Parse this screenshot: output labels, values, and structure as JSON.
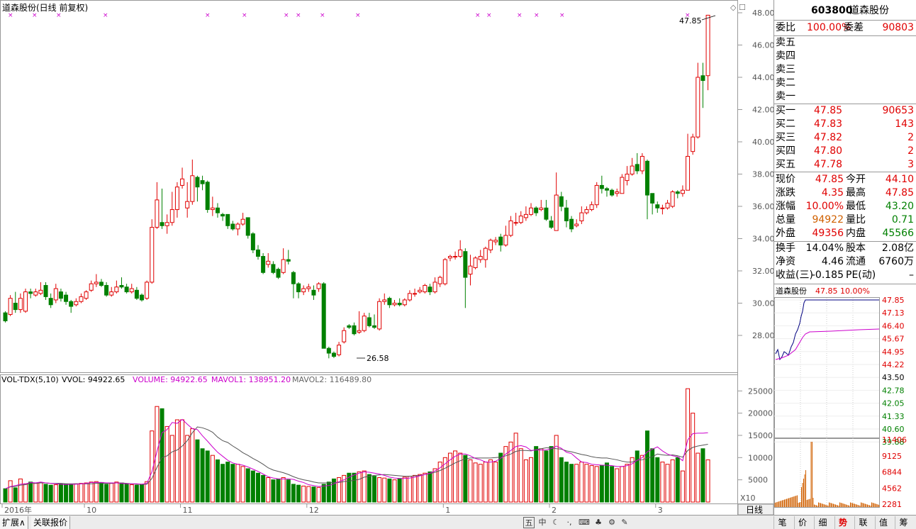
{
  "chart": {
    "title": "道森股份(日线 前复权)",
    "price_axis_ticks": [
      "48.00",
      "46.00",
      "44.00",
      "42.00",
      "40.00",
      "38.00",
      "36.00",
      "34.00",
      "32.00",
      "30.00",
      "28.00"
    ],
    "high_marker": "47.85",
    "low_marker": "26.58",
    "vol_legend": {
      "name": "VOL-TDX(5,10)",
      "vvol": "VVOL: 94922.65",
      "volume": "VOLUME: 94922.65",
      "mavol1": "MAVOL1: 138951.20",
      "mavol2": "MAVOL2: 116489.80"
    },
    "vol_axis_ticks": [
      "25000",
      "20000",
      "15000",
      "10000",
      "5000"
    ],
    "vol_unit": "X10",
    "period_label": "日线",
    "date_labels": [
      "2016年",
      "10",
      "11",
      "12",
      "1",
      "2",
      "3"
    ],
    "colors": {
      "up": "#e00000",
      "down": "#008000",
      "ma1": "#cc00cc",
      "ma2": "#555555",
      "marker": "#cc00cc"
    }
  },
  "chart_data": {
    "type": "candlestick",
    "title": "道森股份(日线 前复权)",
    "ylim": [
      26,
      48
    ],
    "candles": [
      [
        29.4,
        28.9,
        29.5,
        28.8
      ],
      [
        29.3,
        30.3,
        30.5,
        29.2
      ],
      [
        30.0,
        29.6,
        30.7,
        29.4
      ],
      [
        29.6,
        30.3,
        30.6,
        29.4
      ],
      [
        29.5,
        30.7,
        30.9,
        29.4
      ],
      [
        30.7,
        30.6,
        30.9,
        30.3
      ],
      [
        30.5,
        30.7,
        30.9,
        30.4
      ],
      [
        30.6,
        30.8,
        31.3,
        30.5
      ],
      [
        31.1,
        30.4,
        31.3,
        30.2
      ],
      [
        30.3,
        29.9,
        30.6,
        29.7
      ],
      [
        30.2,
        30.9,
        31.2,
        30.0
      ],
      [
        30.7,
        30.3,
        30.9,
        30.1
      ],
      [
        30.5,
        30.1,
        30.7,
        29.9
      ],
      [
        30.1,
        29.8,
        30.2,
        29.4
      ],
      [
        29.9,
        30.1,
        30.3,
        29.8
      ],
      [
        30.1,
        30.4,
        30.6,
        30.0
      ],
      [
        30.3,
        30.7,
        30.8,
        30.2
      ],
      [
        30.8,
        31.2,
        31.4,
        30.7
      ],
      [
        31.2,
        31.3,
        31.8,
        31.0
      ],
      [
        31.3,
        31.1,
        31.5,
        31.0
      ],
      [
        31.1,
        30.5,
        31.3,
        30.4
      ],
      [
        30.5,
        30.7,
        31.0,
        30.4
      ],
      [
        30.7,
        31.0,
        31.4,
        30.6
      ],
      [
        31.1,
        31.0,
        31.6,
        30.9
      ],
      [
        31.0,
        30.7,
        31.2,
        30.6
      ],
      [
        30.7,
        30.9,
        31.2,
        30.6
      ],
      [
        30.8,
        30.3,
        31.0,
        30.2
      ],
      [
        30.5,
        30.2,
        30.6,
        30.1
      ],
      [
        30.3,
        31.3,
        31.4,
        30.2
      ],
      [
        31.3,
        34.7,
        35.2,
        31.2
      ],
      [
        34.7,
        36.4,
        37.5,
        34.6
      ],
      [
        35.0,
        34.8,
        37.1,
        34.6
      ],
      [
        34.8,
        35.0,
        35.5,
        34.3
      ],
      [
        35.0,
        35.8,
        36.9,
        34.8
      ],
      [
        35.8,
        37.2,
        37.5,
        35.3
      ],
      [
        37.3,
        37.7,
        38.4,
        37.1
      ],
      [
        35.9,
        36.3,
        37.5,
        35.3
      ],
      [
        36.3,
        37.9,
        38.9,
        36.1
      ],
      [
        37.8,
        37.2,
        37.9,
        36.3
      ],
      [
        37.6,
        37.4,
        37.9,
        37.0
      ],
      [
        37.5,
        35.8,
        37.6,
        35.6
      ],
      [
        35.8,
        35.9,
        36.6,
        35.4
      ],
      [
        35.9,
        35.6,
        36.2,
        35.3
      ],
      [
        35.5,
        35.4,
        35.6,
        35.1
      ],
      [
        35.5,
        34.8,
        35.5,
        34.6
      ],
      [
        34.9,
        34.6,
        35.1,
        34.5
      ],
      [
        34.6,
        34.9,
        35.0,
        34.2
      ],
      [
        34.9,
        35.2,
        35.6,
        34.8
      ],
      [
        35.3,
        34.2,
        35.3,
        34.0
      ],
      [
        34.3,
        33.3,
        34.4,
        33.1
      ],
      [
        33.3,
        32.9,
        33.6,
        32.7
      ],
      [
        32.9,
        31.9,
        33.1,
        31.8
      ],
      [
        32.4,
        32.6,
        33.1,
        32.2
      ],
      [
        32.4,
        31.9,
        32.6,
        31.8
      ],
      [
        32.1,
        31.6,
        32.2,
        31.5
      ],
      [
        31.9,
        32.7,
        33.4,
        31.8
      ],
      [
        32.7,
        32.6,
        33.3,
        32.4
      ],
      [
        31.9,
        31.2,
        32.0,
        30.3
      ],
      [
        31.2,
        30.7,
        31.3,
        30.3
      ],
      [
        30.7,
        30.9,
        31.1,
        30.5
      ],
      [
        30.9,
        31.0,
        31.2,
        30.7
      ],
      [
        30.8,
        30.5,
        31.1,
        30.2
      ],
      [
        30.9,
        31.2,
        31.3,
        30.7
      ],
      [
        31.2,
        27.2,
        31.3,
        27.2
      ],
      [
        27.2,
        26.9,
        27.3,
        26.58
      ],
      [
        26.9,
        26.7,
        27.0,
        26.6
      ],
      [
        26.8,
        27.4,
        27.6,
        26.7
      ],
      [
        27.6,
        28.3,
        28.5,
        27.5
      ],
      [
        28.6,
        28.5,
        28.7,
        28.4
      ],
      [
        28.6,
        28.1,
        28.8,
        28.0
      ],
      [
        28.2,
        28.3,
        29.5,
        28.1
      ],
      [
        28.3,
        29.2,
        29.4,
        28.2
      ],
      [
        29.1,
        28.6,
        29.4,
        28.5
      ],
      [
        28.6,
        28.5,
        29.3,
        28.4
      ],
      [
        28.4,
        30.1,
        30.3,
        28.3
      ],
      [
        30.1,
        30.2,
        30.6,
        29.9
      ],
      [
        30.3,
        29.9,
        30.4,
        29.7
      ],
      [
        29.9,
        30.0,
        30.2,
        29.8
      ],
      [
        30.0,
        29.9,
        30.3,
        29.8
      ],
      [
        29.9,
        30.2,
        30.3,
        29.8
      ],
      [
        30.2,
        30.6,
        30.8,
        30.1
      ],
      [
        30.6,
        30.6,
        30.9,
        30.4
      ],
      [
        30.7,
        30.8,
        31.0,
        30.6
      ],
      [
        30.7,
        31.1,
        31.2,
        30.6
      ],
      [
        31.0,
        30.7,
        31.2,
        30.5
      ],
      [
        30.7,
        31.3,
        31.6,
        30.6
      ],
      [
        31.2,
        31.6,
        31.7,
        31.0
      ],
      [
        31.2,
        32.7,
        32.8,
        31.1
      ],
      [
        32.8,
        32.9,
        33.0,
        32.6
      ],
      [
        32.9,
        32.9,
        33.2,
        32.7
      ],
      [
        32.9,
        33.3,
        33.9,
        32.8
      ],
      [
        33.2,
        31.6,
        33.4,
        29.7
      ],
      [
        31.8,
        32.3,
        33.0,
        31.1
      ],
      [
        32.2,
        32.8,
        32.9,
        32.1
      ],
      [
        32.7,
        32.9,
        33.3,
        32.5
      ],
      [
        32.7,
        33.4,
        33.5,
        32.2
      ],
      [
        33.3,
        33.9,
        34.0,
        33.1
      ],
      [
        33.8,
        33.9,
        34.1,
        33.6
      ],
      [
        34.1,
        33.6,
        34.3,
        33.2
      ],
      [
        33.6,
        34.2,
        34.8,
        33.5
      ],
      [
        34.2,
        35.1,
        35.4,
        34.1
      ],
      [
        35.0,
        35.0,
        35.6,
        34.8
      ],
      [
        35.0,
        35.4,
        35.7,
        34.9
      ],
      [
        35.3,
        35.5,
        36.0,
        35.1
      ],
      [
        35.5,
        35.9,
        36.2,
        35.4
      ],
      [
        35.9,
        35.6,
        36.0,
        35.4
      ],
      [
        35.8,
        35.9,
        36.4,
        35.7
      ],
      [
        35.9,
        35.2,
        36.4,
        35.1
      ],
      [
        35.1,
        34.7,
        35.4,
        34.6
      ],
      [
        34.5,
        36.7,
        38.1,
        34.5
      ],
      [
        36.6,
        36.0,
        36.9,
        35.7
      ],
      [
        35.9,
        35.1,
        36.4,
        34.7
      ],
      [
        35.2,
        34.6,
        35.4,
        34.4
      ],
      [
        34.8,
        34.9,
        35.2,
        34.7
      ],
      [
        35.1,
        35.6,
        36.0,
        34.9
      ],
      [
        35.6,
        35.8,
        36.0,
        35.5
      ],
      [
        35.8,
        36.1,
        36.3,
        35.7
      ],
      [
        36.1,
        37.3,
        37.5,
        35.9
      ],
      [
        37.3,
        37.1,
        37.9,
        36.8
      ],
      [
        37.1,
        37.0,
        37.2,
        36.6
      ],
      [
        37.0,
        36.7,
        37.1,
        36.6
      ],
      [
        36.8,
        36.9,
        37.1,
        36.6
      ],
      [
        36.8,
        37.8,
        38.0,
        36.8
      ],
      [
        37.6,
        38.0,
        38.5,
        37.3
      ],
      [
        38.0,
        38.5,
        39.0,
        37.9
      ],
      [
        38.6,
        38.2,
        39.3,
        38.0
      ],
      [
        38.2,
        39.1,
        39.3,
        38.0
      ],
      [
        38.8,
        36.7,
        38.9,
        35.2
      ],
      [
        36.8,
        36.2,
        36.8,
        35.5
      ],
      [
        36.1,
        35.9,
        36.3,
        35.6
      ],
      [
        35.9,
        35.9,
        36.1,
        35.5
      ],
      [
        35.9,
        36.2,
        36.4,
        35.8
      ],
      [
        36.0,
        36.9,
        37.0,
        35.9
      ],
      [
        36.9,
        36.8,
        37.0,
        36.5
      ],
      [
        36.8,
        37.0,
        37.3,
        36.6
      ],
      [
        37.0,
        39.1,
        40.5,
        37.0
      ],
      [
        39.4,
        40.3,
        40.5,
        39.2
      ],
      [
        40.3,
        44.0,
        44.9,
        40.2
      ],
      [
        44.1,
        43.8,
        44.9,
        42.1
      ],
      [
        44.1,
        47.85,
        47.85,
        43.2
      ]
    ],
    "volumes": [
      3000,
      4800,
      3200,
      5200,
      4100,
      4500,
      4200,
      4400,
      4000,
      3800,
      3900,
      4100,
      4000,
      3900,
      4100,
      4200,
      4300,
      4500,
      4600,
      4400,
      4000,
      4200,
      4500,
      4300,
      4100,
      3900,
      3800,
      3900,
      4600,
      16000,
      21500,
      21000,
      17000,
      15000,
      18500,
      18500,
      15000,
      16500,
      14000,
      12000,
      11500,
      10500,
      9500,
      8500,
      9000,
      8500,
      8500,
      8000,
      7500,
      7000,
      6500,
      6000,
      5500,
      5000,
      5200,
      5500,
      5000,
      4000,
      3800,
      3600,
      3500,
      3400,
      3300,
      4000,
      4500,
      5200,
      5500,
      6000,
      6500,
      6500,
      6800,
      7000,
      6200,
      5800,
      5500,
      5400,
      5200,
      5000,
      5300,
      5600,
      5800,
      6000,
      6200,
      6500,
      6800,
      7500,
      9000,
      10000,
      11000,
      11500,
      11000,
      10500,
      9500,
      8800,
      8500,
      9000,
      9500,
      9000,
      11000,
      12500,
      13500,
      15500,
      12000,
      9500,
      10000,
      12500,
      12000,
      11500,
      12500,
      15000,
      10000,
      9000,
      8500,
      8500,
      9000,
      8500,
      8200,
      8000,
      8200,
      8800,
      8000,
      7500,
      8000,
      8500,
      10000,
      11500,
      10500,
      16000,
      12000,
      10000,
      9000,
      8500,
      9500,
      10000,
      7000,
      25500,
      20000,
      11000,
      12000,
      9500
    ],
    "vol_ylim": [
      0,
      26000
    ],
    "ma1": [
      3000,
      3500,
      3700,
      4000,
      4100,
      4400,
      4300,
      4500,
      4300,
      4200,
      4100,
      4000,
      3900,
      4000,
      4000,
      4100,
      4200,
      4400,
      4400,
      4400,
      4300,
      4300,
      4300,
      4200,
      4100,
      4100,
      4100,
      4000,
      4200,
      6800,
      11400,
      15600,
      16300,
      17900,
      17700,
      18600,
      17500,
      16500,
      16300,
      14900,
      13700,
      12400,
      11200,
      10300,
      9400,
      8800,
      8500,
      8300,
      7900,
      7400,
      6900,
      6300,
      5700,
      5400,
      5200,
      5200,
      5200,
      5100,
      4700,
      4400,
      3900,
      3700,
      3500,
      3600,
      3700,
      4100,
      4600,
      5000,
      5600,
      6100,
      6500,
      6800,
      6700,
      6500,
      6300,
      6000,
      5600,
      5400,
      5300,
      5300,
      5400,
      5600,
      5900,
      6200,
      6500,
      7000,
      7700,
      8600,
      9500,
      10300,
      10800,
      10800,
      10400,
      9800,
      9500,
      9000,
      9000,
      9200,
      9800,
      10800,
      11600,
      12500,
      12700,
      12400,
      11600,
      11700,
      11700,
      11700,
      12000,
      12600,
      12100,
      11200,
      10900,
      9900,
      9000,
      8900,
      8500,
      8400,
      8300,
      8300,
      8200,
      8000,
      8000,
      8200,
      8600,
      9400,
      10000,
      11300,
      11900,
      12400,
      11500,
      10800,
      10400,
      10200,
      9300,
      14000,
      15400,
      15500,
      15500,
      15600
    ],
    "ma2": [
      3000,
      3400,
      3500,
      3800,
      3900,
      4200,
      4200,
      4300,
      4300,
      4200,
      4200,
      4200,
      4100,
      4100,
      4100,
      4100,
      4100,
      4100,
      4200,
      4200,
      4200,
      4200,
      4300,
      4300,
      4200,
      4100,
      4000,
      4000,
      4000,
      5300,
      7800,
      10000,
      10400,
      11300,
      11700,
      12600,
      13800,
      15600,
      16900,
      16700,
      16300,
      15700,
      14600,
      13800,
      13400,
      12600,
      11900,
      11100,
      10500,
      9800,
      9200,
      8500,
      7700,
      7200,
      6900,
      6600,
      6200,
      5700,
      5300,
      5000,
      4800,
      4500,
      4300,
      4300,
      4300,
      4400,
      4400,
      4600,
      4700,
      4900,
      5100,
      5600,
      5800,
      6000,
      6100,
      6200,
      6100,
      6000,
      5900,
      5800,
      5800,
      5900,
      6000,
      6200,
      6400,
      6700,
      7100,
      7600,
      8200,
      8800,
      9300,
      9700,
      9900,
      9900,
      9900,
      9900,
      9900,
      10000,
      10100,
      10400,
      10800,
      11400,
      11600,
      11600,
      11500,
      11800,
      12000,
      12200,
      12200,
      12000,
      11900,
      11500,
      11300,
      11000,
      10700,
      10500,
      10200,
      10000,
      9900,
      9900,
      9700,
      9500,
      9200,
      9000,
      9000,
      9400,
      9500,
      9900,
      10200,
      10800,
      10600,
      10500,
      10600,
      10400,
      10100,
      11600,
      12300,
      12600,
      12800,
      13000
    ]
  },
  "quote": {
    "code": "603800",
    "name": "道森股份",
    "weibi_label": "委比",
    "weibi_value": "100.00%",
    "weicha_label": "委差",
    "weicha_value": "90803",
    "sell": [
      {
        "label": "卖五",
        "price": "",
        "vol": ""
      },
      {
        "label": "卖四",
        "price": "",
        "vol": ""
      },
      {
        "label": "卖三",
        "price": "",
        "vol": ""
      },
      {
        "label": "卖二",
        "price": "",
        "vol": ""
      },
      {
        "label": "卖一",
        "price": "",
        "vol": ""
      }
    ],
    "buy": [
      {
        "label": "买一",
        "price": "47.85",
        "vol": "90653"
      },
      {
        "label": "买二",
        "price": "47.83",
        "vol": "143"
      },
      {
        "label": "买三",
        "price": "47.82",
        "vol": "2"
      },
      {
        "label": "买四",
        "price": "47.80",
        "vol": "2"
      },
      {
        "label": "买五",
        "price": "47.78",
        "vol": "3"
      }
    ],
    "stats": [
      {
        "l1": "现价",
        "v1": "47.85",
        "c1": "red",
        "l2": "今开",
        "v2": "44.10",
        "c2": "red"
      },
      {
        "l1": "涨跌",
        "v1": "4.35",
        "c1": "red",
        "l2": "最高",
        "v2": "47.85",
        "c2": "red"
      },
      {
        "l1": "涨幅",
        "v1": "10.00%",
        "c1": "red",
        "l2": "最低",
        "v2": "43.20",
        "c2": "green"
      },
      {
        "l1": "总量",
        "v1": "94922",
        "c1": "orange",
        "l2": "量比",
        "v2": "0.71",
        "c2": "green"
      },
      {
        "l1": "外盘",
        "v1": "49356",
        "c1": "red",
        "l2": "内盘",
        "v2": "45566",
        "c2": "green"
      }
    ],
    "stats2": [
      {
        "l1": "换手",
        "v1": "14.04%",
        "l2": "股本",
        "v2": "2.08亿"
      },
      {
        "l1": "净资",
        "v1": "4.46",
        "l2": "流通",
        "v2": "6760万"
      },
      {
        "l1": "收益(三)",
        "v1": "-0.185",
        "l2": "PE(动)",
        "v2": "–"
      }
    ]
  },
  "mini": {
    "title": "道森股份",
    "price": "47.85",
    "pct": "10.00%",
    "price_ticks_red": [
      "47.85",
      "47.13",
      "46.40",
      "45.67",
      "44.95",
      "44.22"
    ],
    "price_mid": "43.50",
    "price_ticks_green": [
      "42.78",
      "42.05",
      "41.33",
      "40.60",
      "39.88"
    ],
    "vol_ticks": [
      "11406",
      "9125",
      "6844",
      "4562",
      "2281"
    ]
  },
  "tabs": {
    "left": [
      "扩展∧",
      "关联报价"
    ],
    "right": [
      "笔",
      "价",
      "细",
      "势",
      "联",
      "值",
      "筹"
    ]
  },
  "toolbar_icons": [
    "五",
    "中",
    "☾",
    "·,",
    "⌨",
    "♣",
    "⚙",
    "✎"
  ]
}
